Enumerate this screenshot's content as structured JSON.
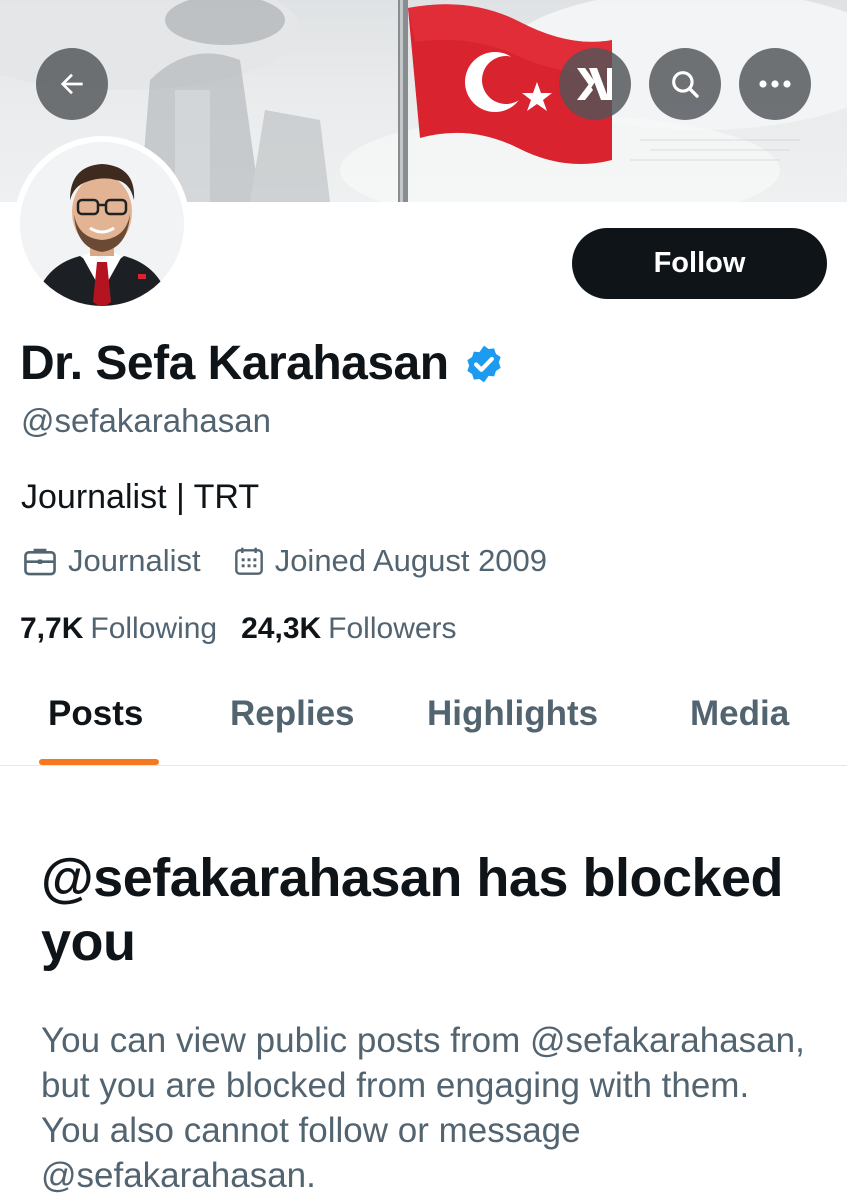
{
  "header": {
    "back_icon": "arrow-left-icon",
    "xai_label": "xI",
    "search_icon": "search-icon",
    "more_icon": "more-horizontal-icon"
  },
  "profile": {
    "name": "Dr. Sefa Karahasan",
    "verified_icon": "verified-badge-icon",
    "verified_color": "#1d9bf0",
    "handle": "@sefakarahasan",
    "bio": "Journalist | TRT",
    "profession": "Journalist",
    "joined": "Joined August 2009",
    "following_count": "7,7K",
    "following_label": "Following",
    "followers_count": "24,3K",
    "followers_label": "Followers"
  },
  "actions": {
    "follow_label": "Follow"
  },
  "tabs": [
    {
      "label": "Posts",
      "active": true
    },
    {
      "label": "Replies",
      "active": false
    },
    {
      "label": "Highlights",
      "active": false
    },
    {
      "label": "Media",
      "active": false
    }
  ],
  "notice": {
    "title": "@sefakarahasan has blocked you",
    "body": "You can view public posts from @sefakarahasan, but you are blocked from engaging with them. You also cannot follow or message @sefakarahasan."
  },
  "colors": {
    "accent_tab": "#f7791e",
    "follow_bg": "#0f1419",
    "secondary_text": "#536471",
    "flag_red": "#d9232e"
  }
}
